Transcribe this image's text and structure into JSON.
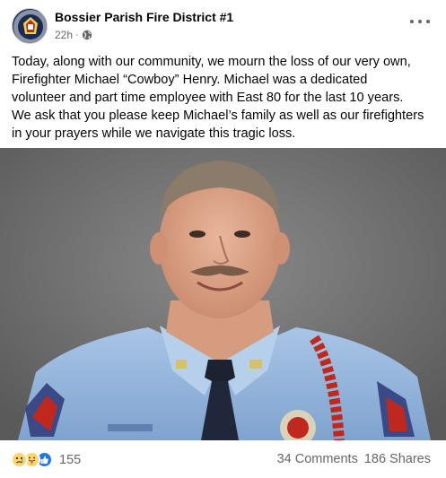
{
  "post": {
    "page_name": "Bossier Parish Fire District #1",
    "time": "22h",
    "audience_icon": "globe-icon",
    "more_icon": "more-horizontal-icon",
    "text": "Today, along with our community, we mourn the loss of our very own,\nFirefighter Michael “Cowboy” Henry. Michael was a dedicated\nvolunteer and part time employee with East 80 for the last 10 years.\nWe ask that you please keep Michael’s family as well as our firefighters\nin your prayers while we navigate this tragic loss."
  },
  "stats": {
    "reaction_icons": [
      "sad-reaction-icon",
      "care-reaction-icon",
      "like-reaction-icon"
    ],
    "reaction_count": "155",
    "comments": "34 Comments",
    "shares": "186 Shares"
  },
  "colors": {
    "secondary_text": "#65676b",
    "like_blue": "#1877f2",
    "shirt_blue": "#8fb3dc"
  }
}
